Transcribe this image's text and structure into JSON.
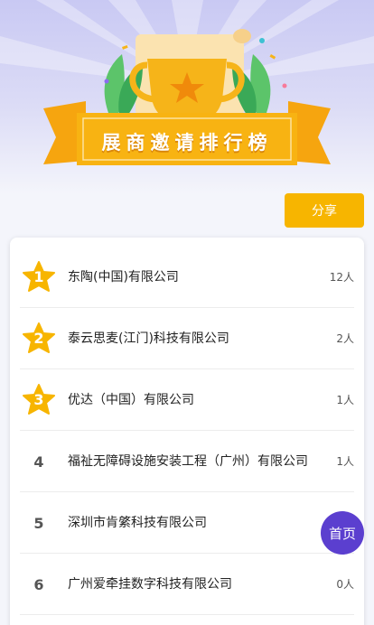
{
  "banner": {
    "title": "展商邀请排行榜"
  },
  "toolbar": {
    "share_label": "分享"
  },
  "ranking": [
    {
      "rank": "1",
      "name": "东陶(中国)有限公司",
      "count": "12人"
    },
    {
      "rank": "2",
      "name": "泰云思麦(江门)科技有限公司",
      "count": "2人"
    },
    {
      "rank": "3",
      "name": "优达（中国）有限公司",
      "count": "1人"
    },
    {
      "rank": "4",
      "name": "福祉无障碍设施安装工程（广州）有限公司",
      "count": "1人"
    },
    {
      "rank": "5",
      "name": "深圳市肯綮科技有限公司",
      "count": ""
    },
    {
      "rank": "6",
      "name": "广州爱牵挂数字科技有限公司",
      "count": "0人"
    }
  ],
  "floating": {
    "home_label": "首页"
  },
  "icons": {
    "trophy": "trophy-icon",
    "medal": "star-medal-icon"
  },
  "colors": {
    "accent": "#f7b500",
    "home_button": "#5b3fcf"
  }
}
